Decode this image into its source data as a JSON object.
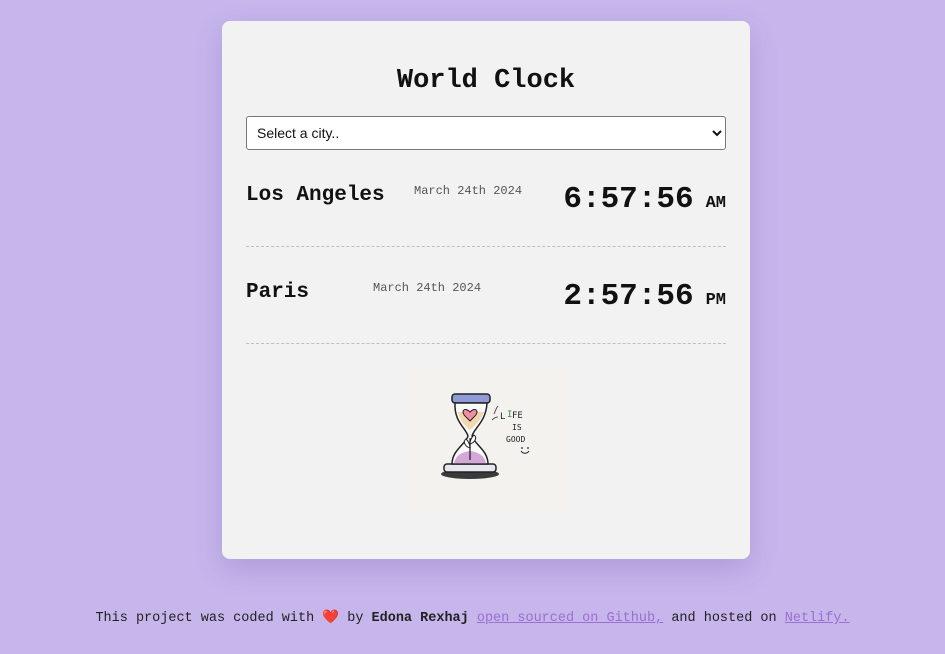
{
  "app": {
    "title": "World Clock"
  },
  "city_select": {
    "selected": "Select a city.."
  },
  "cities": [
    {
      "name": "Los Angeles",
      "date": "March 24th 2024",
      "time": "6:57:56",
      "ampm": "AM"
    },
    {
      "name": "Paris",
      "date": "March 24th 2024",
      "time": "2:57:56",
      "ampm": "PM"
    }
  ],
  "illustration": {
    "icon": "hourglass-life-is-good-icon",
    "text": "LIFE IS GOOD"
  },
  "footer": {
    "prefix": "This project was coded with",
    "heart": "❤️",
    "by": "by",
    "author": "Edona Rexhaj",
    "github_link": "open sourced on Github,",
    "middle": "and hosted on",
    "netlify_link": "Netlify."
  },
  "colors": {
    "background": "#c6b6ec",
    "card": "#f2f2f2",
    "link": "#9b6fd0"
  }
}
